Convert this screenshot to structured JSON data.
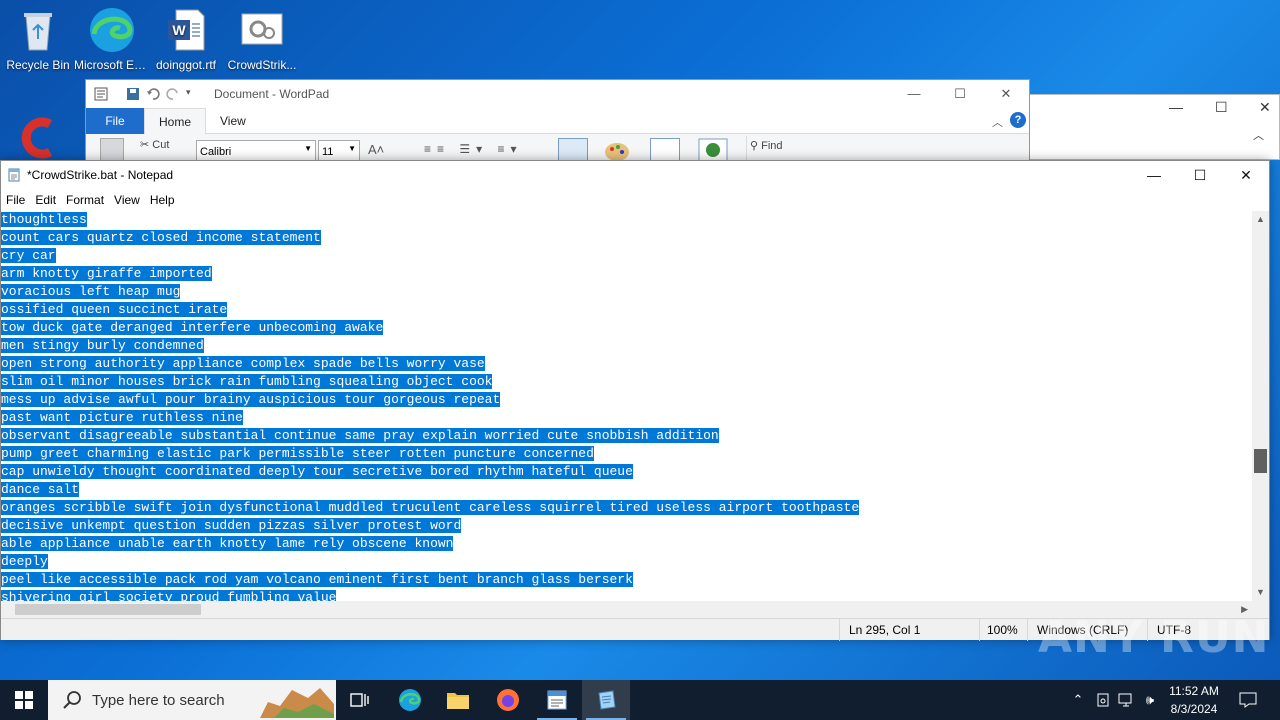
{
  "desktop": {
    "icons": [
      {
        "label": "Recycle Bin"
      },
      {
        "label": "Microsoft Edge"
      },
      {
        "label": "doinggot.rtf"
      },
      {
        "label": "CrowdStrik..."
      }
    ]
  },
  "wordpad": {
    "title": "Document - WordPad",
    "tabs": {
      "file": "File",
      "home": "Home",
      "view": "View"
    },
    "ribbon": {
      "cut": "Cut",
      "font": "Calibri",
      "size": "11",
      "find": "Find"
    }
  },
  "notepad": {
    "title": "*CrowdStrike.bat - Notepad",
    "menu": [
      "File",
      "Edit",
      "Format",
      "View",
      "Help"
    ],
    "lines": [
      "thoughtless",
      "count cars quartz closed income statement",
      "cry car",
      "arm knotty giraffe imported",
      "voracious left heap mug",
      "ossified queen succinct irate",
      "tow duck gate deranged interfere unbecoming awake",
      "men stingy burly condemned",
      "open strong authority appliance complex spade bells worry vase",
      "slim oil minor houses brick rain fumbling squealing object cook",
      "mess up advise awful pour brainy auspicious tour gorgeous repeat",
      "past want picture ruthless nine",
      "observant disagreeable substantial continue same pray explain worried cute snobbish addition",
      "pump greet charming elastic park permissible steer rotten puncture concerned",
      "cap unwieldy thought coordinated deeply tour secretive bored rhythm hateful queue",
      "dance salt",
      "oranges scribble swift join dysfunctional muddled truculent careless squirrel tired useless airport toothpaste",
      "decisive unkempt question sudden pizzas silver protest word",
      "able appliance unable earth knotty lame rely obscene known",
      "deeply",
      "peel like accessible pack rod yam volcano eminent first bent branch glass berserk",
      "shivering girl society proud fumbling value"
    ],
    "status": {
      "position": "Ln 295, Col 1",
      "zoom": "100%",
      "line_ending": "Windows (CRLF)",
      "encoding": "UTF-8"
    }
  },
  "watermark": "ANY RUN",
  "taskbar": {
    "search_placeholder": "Type here to search",
    "time": "11:52 AM",
    "date": "8/3/2024"
  },
  "colors": {
    "selection": "#0078d7",
    "taskbar": "#101e2f",
    "accent": "#1e6ccb"
  }
}
